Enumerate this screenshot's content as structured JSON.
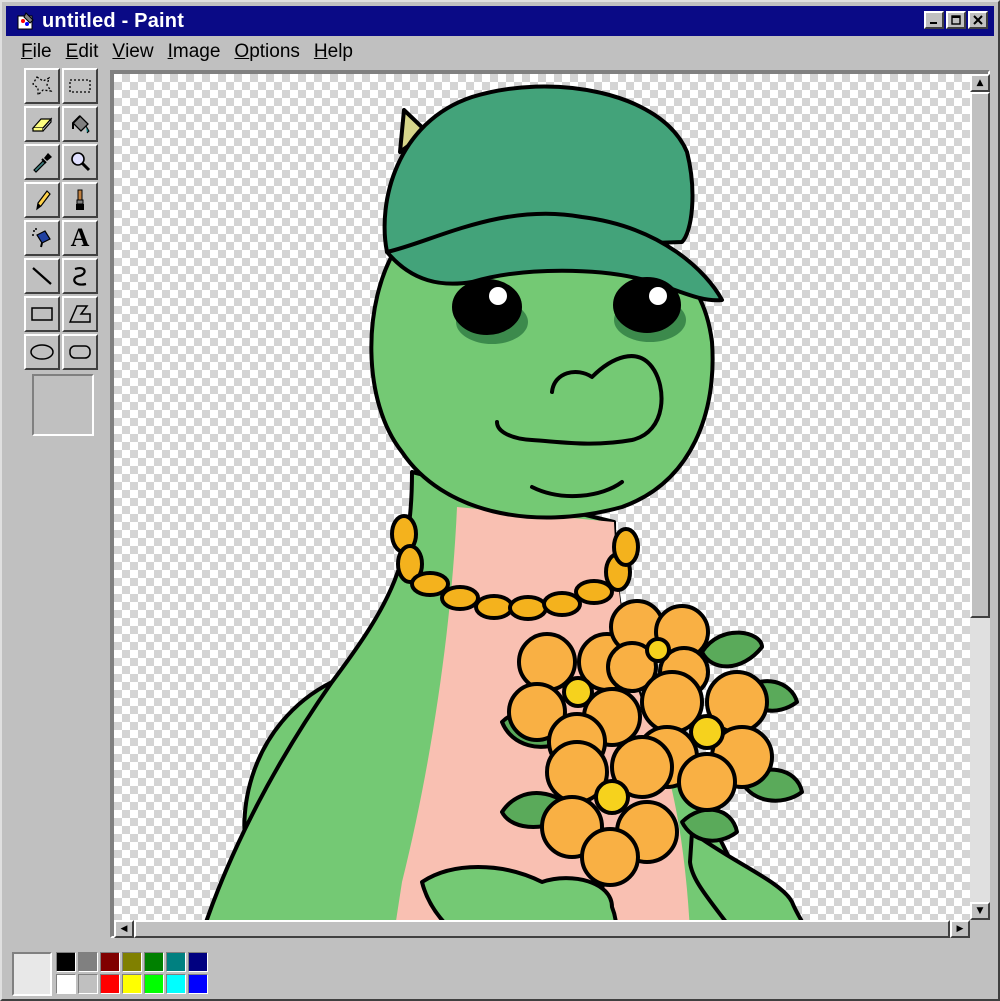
{
  "window": {
    "title": "untitled - Paint"
  },
  "menu": [
    {
      "key": "F",
      "rest": "ile"
    },
    {
      "key": "E",
      "rest": "dit"
    },
    {
      "key": "V",
      "rest": "iew"
    },
    {
      "key": "I",
      "rest": "mage"
    },
    {
      "key": "O",
      "rest": "ptions"
    },
    {
      "key": "H",
      "rest": "elp"
    }
  ],
  "tools": [
    "free-form-select",
    "select",
    "eraser",
    "fill-with-color",
    "pick-color",
    "magnifier",
    "pencil",
    "brush",
    "airbrush",
    "text",
    "line",
    "curve",
    "rectangle",
    "polygon",
    "ellipse",
    "rounded-rectangle"
  ],
  "tool_text_glyph": "A",
  "palette": {
    "row1": [
      "#000000",
      "#808080",
      "#800000",
      "#808000",
      "#008000",
      "#008080",
      "#000080"
    ],
    "row2": [
      "#ffffff",
      "#c0c0c0",
      "#ff0000",
      "#ffff00",
      "#00ff00",
      "#00ffff",
      "#0000ff"
    ]
  },
  "colors": {
    "titlebar": "#0a0a86",
    "dino_body": "#74c974",
    "cap": "#43a37a",
    "belly": "#f9c0b2",
    "flower": "#f9b044",
    "chain": "#f4b21d"
  }
}
